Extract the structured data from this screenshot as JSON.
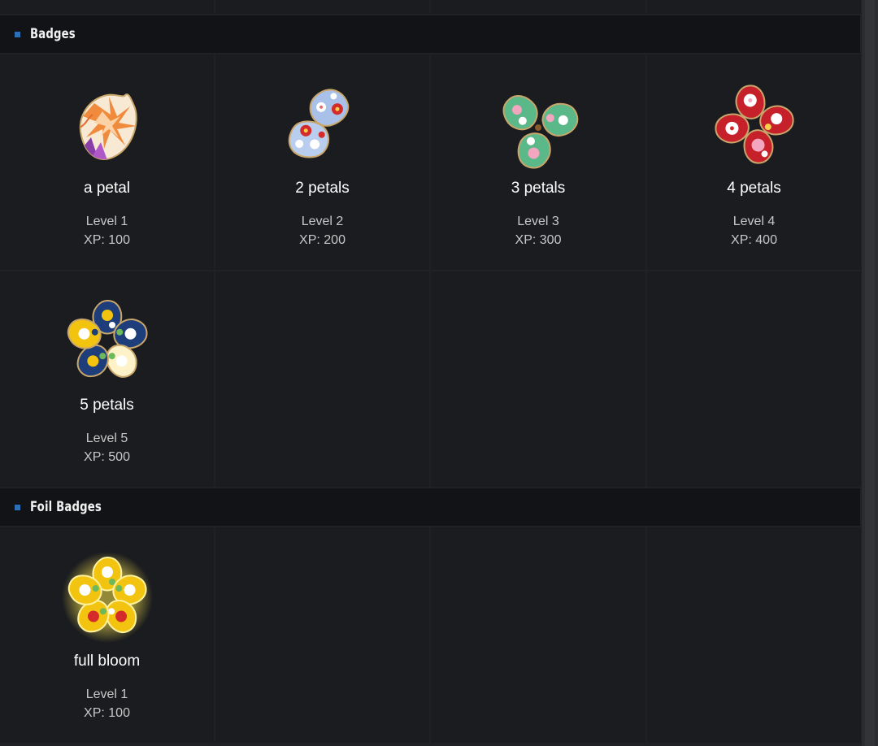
{
  "sections": [
    {
      "title": "Badges",
      "badges": [
        {
          "name": "a petal",
          "level": "Level 1",
          "xp": "XP: 100",
          "icon": "one-petal-badge-icon"
        },
        {
          "name": "2 petals",
          "level": "Level 2",
          "xp": "XP: 200",
          "icon": "two-petals-badge-icon"
        },
        {
          "name": "3 petals",
          "level": "Level 3",
          "xp": "XP: 300",
          "icon": "three-petals-badge-icon"
        },
        {
          "name": "4 petals",
          "level": "Level 4",
          "xp": "XP: 400",
          "icon": "four-petals-badge-icon"
        },
        {
          "name": "5 petals",
          "level": "Level 5",
          "xp": "XP: 500",
          "icon": "five-petals-badge-icon"
        }
      ]
    },
    {
      "title": "Foil Badges",
      "badges": [
        {
          "name": "full bloom",
          "level": "Level 1",
          "xp": "XP: 100",
          "icon": "full-bloom-foil-badge-icon"
        }
      ]
    }
  ],
  "colors": {
    "section_bullet": "#2b6fb8",
    "petal_orange": "#f08a3c",
    "petal_blue": "#a9c1e8",
    "petal_green": "#5bb889",
    "petal_red": "#c6202a",
    "petal_navy": "#1d3e7a",
    "petal_gold": "#f2c40f"
  }
}
